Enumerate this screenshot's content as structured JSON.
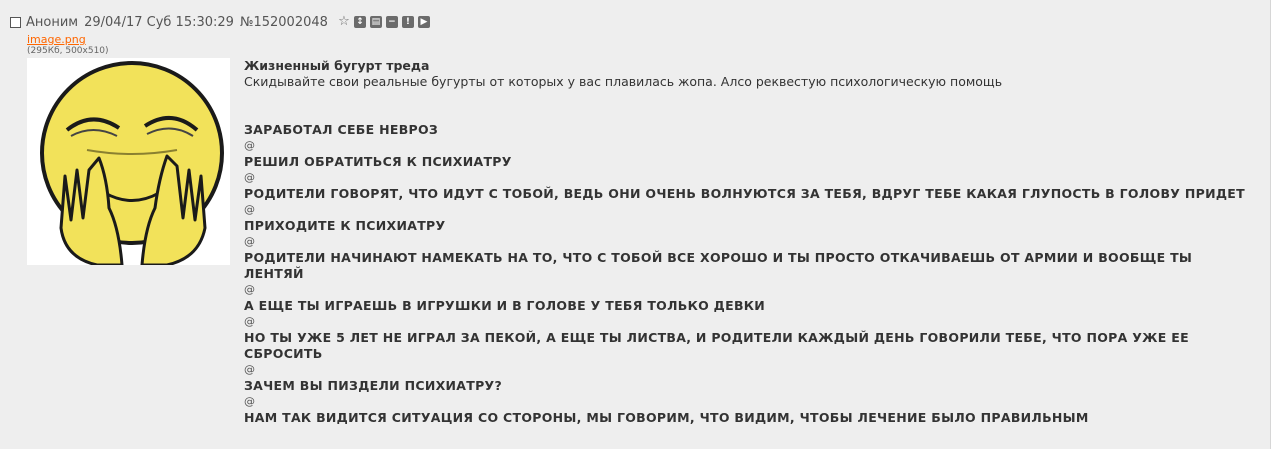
{
  "header": {
    "author": "Аноним",
    "datetime": "29/04/17 Суб 15:30:29",
    "post_number": "№152002048",
    "icons": [
      "star-icon",
      "expand-icon",
      "hide-icon",
      "minus-icon",
      "report-icon",
      "play-icon"
    ]
  },
  "file": {
    "name": "image.png",
    "meta": "(295Кб, 500x510)"
  },
  "post": {
    "subject": "Жизненный бугурт треда",
    "intro": "Скидывайте свои реальные бугурты от которых у вас плавилась жопа. Алсо реквестую психологическую помощь",
    "lines": [
      {
        "text": "ЗАРАБОТАЛ СЕБЕ НЕВРОЗ",
        "kind": "bold"
      },
      {
        "text": "@",
        "kind": "at"
      },
      {
        "text": "РЕШИЛ ОБРАТИТЬСЯ К ПСИХИАТРУ",
        "kind": "bold"
      },
      {
        "text": "@",
        "kind": "at"
      },
      {
        "text": "РОДИТЕЛИ ГОВОРЯТ, ЧТО ИДУТ С ТОБОЙ, ВЕДЬ ОНИ ОЧЕНЬ ВОЛНУЮТСЯ ЗА ТЕБЯ, ВДРУГ ТЕБЕ КАКАЯ ГЛУПОСТЬ В ГОЛОВУ ПРИДЕТ",
        "kind": "bold"
      },
      {
        "text": "@",
        "kind": "at"
      },
      {
        "text": "ПРИХОДИТЕ К ПСИХИАТРУ",
        "kind": "bold"
      },
      {
        "text": "@",
        "kind": "at"
      },
      {
        "text": "РОДИТЕЛИ НАЧИНАЮТ НАМЕКАТЬ НА ТО, ЧТО С ТОБОЙ ВСЕ ХОРОШО И ТЫ ПРОСТО ОТКАЧИВАЕШЬ ОТ АРМИИ И ВООБЩЕ ТЫ ЛЕНТЯЙ",
        "kind": "bold"
      },
      {
        "text": "@",
        "kind": "at"
      },
      {
        "text": "А ЕЩЕ ТЫ ИГРАЕШЬ В ИГРУШКИ И В ГОЛОВЕ У ТЕБЯ ТОЛЬКО ДЕВКИ",
        "kind": "bold"
      },
      {
        "text": "@",
        "kind": "at"
      },
      {
        "text": "НО ТЫ УЖЕ 5 ЛЕТ НЕ ИГРАЛ ЗА ПЕКОЙ, А ЕЩЕ ТЫ ЛИСТВА, И РОДИТЕЛИ КАЖДЫЙ ДЕНЬ ГОВОРИЛИ ТЕБЕ, ЧТО ПОРА УЖЕ ЕЕ СБРОСИТЬ",
        "kind": "bold"
      },
      {
        "text": "@",
        "kind": "at"
      },
      {
        "text": "ЗАЧЕМ ВЫ ПИЗДЕЛИ ПСИХИАТРУ?",
        "kind": "bold"
      },
      {
        "text": "@",
        "kind": "at"
      },
      {
        "text": "НАМ ТАК ВИДИТСЯ СИТУАЦИЯ СО СТОРОНЫ, МЫ ГОВОРИМ, ЧТО ВИДИМ, ЧТОБЫ ЛЕЧЕНИЕ БЫЛО ПРАВИЛЬНЫМ",
        "kind": "bold"
      }
    ]
  },
  "colors": {
    "background": "#eeeeee",
    "text": "#333333",
    "file_link": "#ff6600",
    "face": "#f2e25a"
  }
}
